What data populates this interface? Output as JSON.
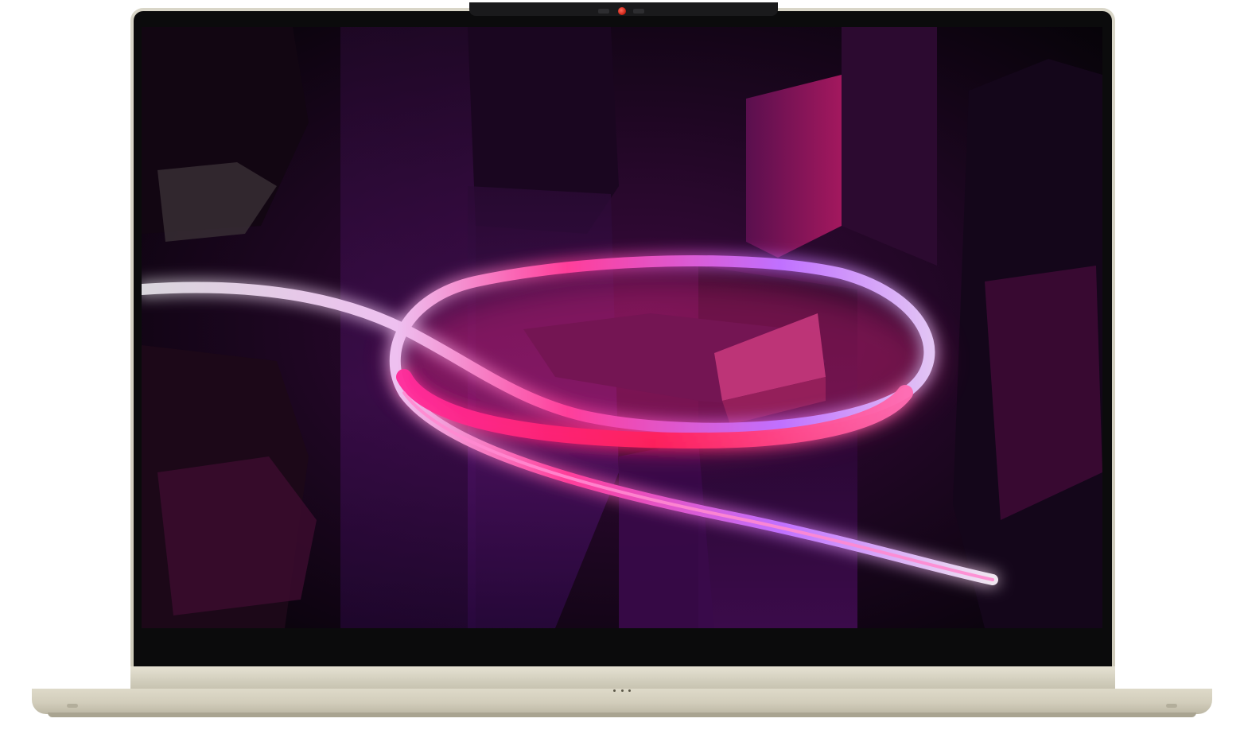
{
  "scene": {
    "subject": "laptop-front-view",
    "wallpaper": "abstract-neon-light-ribbon",
    "colors": {
      "chassis": "#d6d2c2",
      "bezel": "#0b0b0c",
      "accent_pink": "#ff2f8a",
      "accent_violet": "#a23cff",
      "camera_indicator": "#d1281b"
    },
    "icons": {
      "camera": "webcam-icon",
      "microphone": "mic-dots-icon"
    }
  }
}
